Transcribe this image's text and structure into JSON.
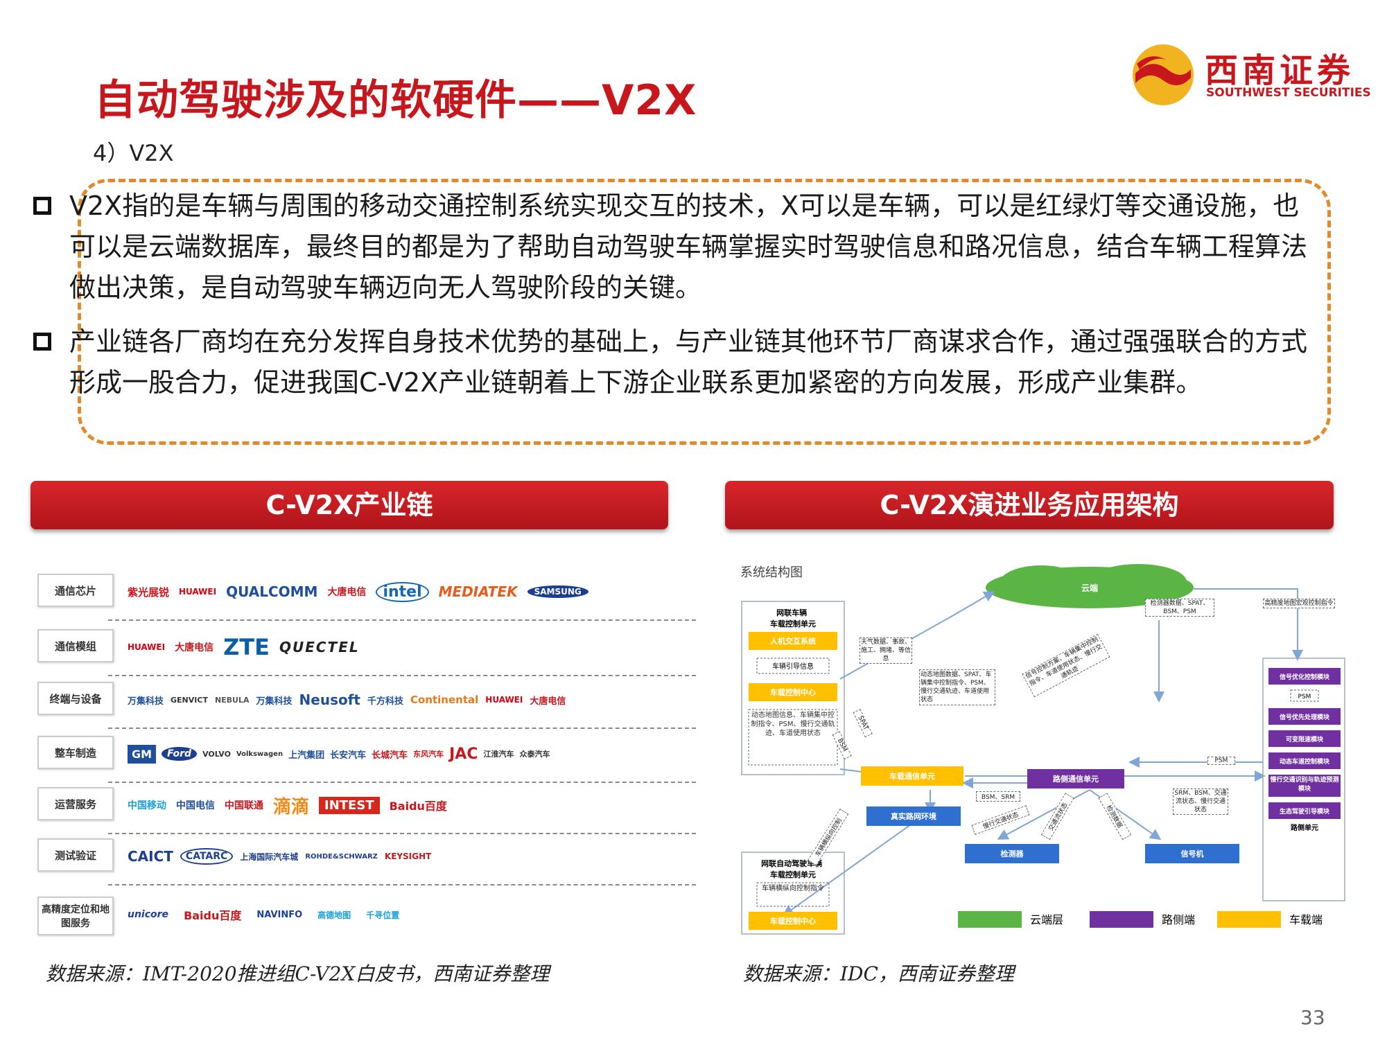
{
  "title": "自动驾驶涉及的软硬件——V2X",
  "brand": {
    "cn": "西南证券",
    "en": "SOUTHWEST SECURITIES",
    "red": "#c8161d",
    "yellow": "#f2b320"
  },
  "subheading": "4）V2X",
  "bullets": [
    "V2X指的是车辆与周围的移动交通控制系统实现交互的技术，X可以是车辆，可以是红绿灯等交通设施，也可以是云端数据库，最终目的都是为了帮助自动驾驶车辆掌握实时驾驶信息和路况信息，结合车辆工程算法做出决策，是自动驾驶车辆迈向无人驾驶阶段的关键。",
    "产业链各厂商均在充分发挥自身技术优势的基础上，与产业链其他环节厂商谋求合作，通过强强联合的方式形成一股合力，促进我国C-V2X产业链朝着上下游企业联系更加紧密的方向发展，形成产业集群。"
  ],
  "left_panel": {
    "title": "C-V2X产业链",
    "rows": [
      {
        "label": "通信芯片",
        "logos": [
          "紫光展锐",
          "HUAWEI",
          "QUALCOMM",
          "大唐电信",
          "intel",
          "MEDIATEK",
          "SAMSUNG"
        ]
      },
      {
        "label": "通信模组",
        "logos": [
          "HUAWEI",
          "大唐电信",
          "ZTE",
          "QUECTEL"
        ]
      },
      {
        "label": "终端与设备",
        "logos": [
          "万集科技",
          "GENVICT",
          "NEBULA",
          "万集科技",
          "Neusoft",
          "千方科技",
          "Continental",
          "HUAWEI",
          "大唐电信"
        ]
      },
      {
        "label": "整车制造",
        "logos": [
          "GM",
          "Ford",
          "VOLVO",
          "Volkswagen",
          "上汽集团",
          "长安汽车",
          "长城汽车",
          "东风汽车",
          "JAC",
          "江淮汽车",
          "众泰汽车"
        ]
      },
      {
        "label": "运营服务",
        "logos": [
          "中国移动",
          "中国电信",
          "中国联通",
          "滴滴",
          "INTEST",
          "Baidu百度"
        ]
      },
      {
        "label": "测试验证",
        "logos": [
          "CAICT",
          "CATARC",
          "上海国际汽车城",
          "ROHDE&SCHWARZ",
          "KEYSIGHT"
        ]
      },
      {
        "label": "高精度定位和地图服务",
        "logos": [
          "unicore",
          "Baidu百度",
          "NAVINFO",
          "高德地图",
          "千寻位置"
        ]
      }
    ],
    "source": "数据来源：IMT-2020推进组C-V2X白皮书，西南证券整理"
  },
  "right_panel": {
    "title": "C-V2X演进业务应用架构",
    "diagram_title": "系统结构图",
    "cloud": "云端",
    "vehicle_unit": {
      "title": "网联车辆\n车载控制单元",
      "items": [
        "人机交互系统",
        "车辆引导信息",
        "车载控制中心",
        "动态地图信息、车辆集中控制指令、PSM、慢行交通轨迹、车道使用状态"
      ]
    },
    "auto_vehicle_unit": {
      "title": "网联自动驾驶车辆\n车载控制单元",
      "items": [
        "车辆横纵向控制指令",
        "车载控制中心"
      ]
    },
    "obu": "车载通信单元",
    "rsu": "路侧通信单元",
    "env": "真实路网环境",
    "detector": "检测器",
    "signal": "信号机",
    "road_modules": [
      "信号优化控制模块",
      "PSM",
      "信号优先处理模块",
      "可变限速模块",
      "动态车道控制模块",
      "慢行交通识别与轨迹预测模块",
      "生态驾驶引导模块"
    ],
    "road_unit": "路侧单元",
    "labels": {
      "cloud_data": "检测器数据、SPAT、BSM、PSM",
      "hd_map": "高精度地图宏观控制指令",
      "weather": "天气数据、事故、施工、拥堵、等信息",
      "dyn_map": "动态地图数据、SPAT、车辆集中控制指令、PSM、慢行交通轨迹、车道使用状态",
      "signal_plan": "信号控制方案、车辆集中控制指令、车道使用状态、慢行交通轨迹",
      "spat": "SPAT",
      "bsm": "BSM",
      "bsm_srm": "BSM、SRM",
      "psm": "PSM",
      "srm_bsm": "SRM、BSM、交通流状态、慢行交通状态",
      "slow": "慢行交通状态",
      "vehicle_ctrl": "车辆横纵向控制",
      "traffic_state": "交通流状态",
      "detection": "检测数据"
    },
    "legend": [
      {
        "label": "云端层",
        "color": "#5ab544"
      },
      {
        "label": "路侧端",
        "color": "#7030a0"
      },
      {
        "label": "车载端",
        "color": "#ffc000"
      }
    ],
    "source": "数据来源：IDC，西南证券整理"
  },
  "page_number": "33"
}
